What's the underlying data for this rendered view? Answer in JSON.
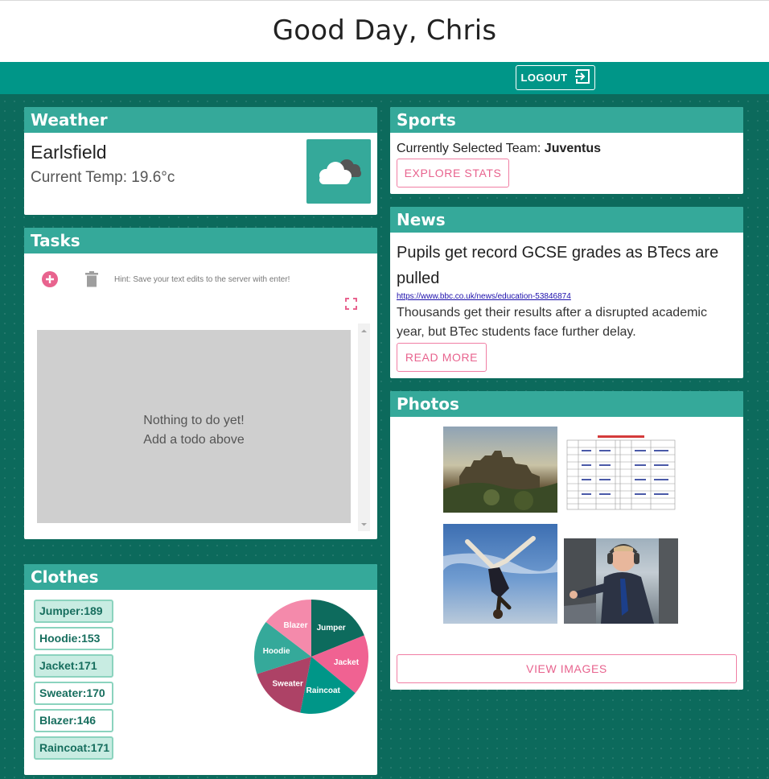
{
  "header": {
    "greeting": "Good Day, Chris"
  },
  "nav": {
    "logout_label": "LOGOUT"
  },
  "weather": {
    "title": "Weather",
    "location": "Earlsfield",
    "temp_text": "Current Temp: 19.6°c",
    "icon": "cloud-icon"
  },
  "tasks": {
    "title": "Tasks",
    "hint": "Hint: Save your text edits to the server with enter!",
    "empty_line1": "Nothing to do yet!",
    "empty_line2": "Add a todo above"
  },
  "clothes": {
    "title": "Clothes",
    "items": [
      {
        "label": "Jumper:189"
      },
      {
        "label": "Hoodie:153"
      },
      {
        "label": "Jacket:171"
      },
      {
        "label": "Sweater:170"
      },
      {
        "label": "Blazer:146"
      },
      {
        "label": "Raincoat:171"
      }
    ],
    "chart_data": {
      "type": "pie",
      "categories": [
        "Jumper",
        "Jacket",
        "Raincoat",
        "Sweater",
        "Hoodie",
        "Blazer"
      ],
      "values": [
        189,
        171,
        171,
        170,
        153,
        146
      ],
      "colors": [
        "#0d6b5d",
        "#f06292",
        "#009688",
        "#ad4266",
        "#35a99a",
        "#f48aab"
      ]
    }
  },
  "sports": {
    "title": "Sports",
    "team_prefix": "Currently Selected Team: ",
    "team": "Juventus",
    "button": "EXPLORE STATS"
  },
  "news": {
    "title": "News",
    "headline_line1": "Pupils get record GCSE grades as BTecs are",
    "headline_line2": "pulled",
    "link": "https://www.bbc.co.uk/news/education-53846874",
    "summary_line1": "Thousands get their results after a disrupted academic",
    "summary_line2": "year, but BTec students face further delay.",
    "button": "READ MORE"
  },
  "photos": {
    "title": "Photos",
    "button": "VIEW IMAGES"
  },
  "colors": {
    "primary": "#009688",
    "card_header": "#35a99a",
    "accent_pink": "#f06292",
    "background": "#0c6a5c"
  }
}
